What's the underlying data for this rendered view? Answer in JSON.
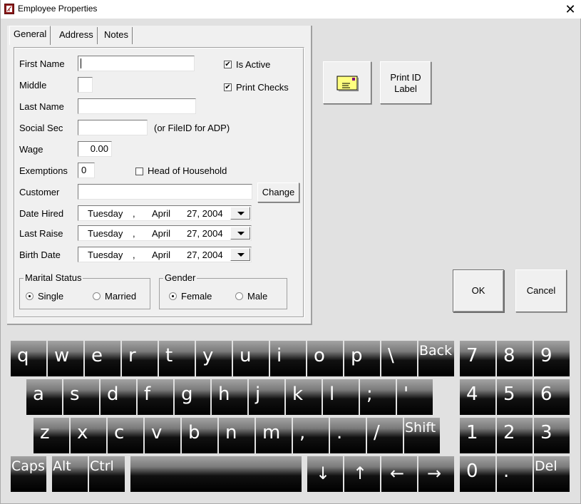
{
  "window": {
    "title": "Employee Properties",
    "close_icon": "close-icon",
    "app_icon": "app-icon"
  },
  "tabs": [
    {
      "label": "General",
      "active": true
    },
    {
      "label": "Address",
      "active": false
    },
    {
      "label": "Notes",
      "active": false
    }
  ],
  "form": {
    "first_name": {
      "label": "First Name",
      "value": ""
    },
    "middle": {
      "label": "Middle",
      "value": ""
    },
    "last_name": {
      "label": "Last Name",
      "value": ""
    },
    "social_sec": {
      "label": "Social Sec",
      "value": "",
      "hint": "(or FileID for ADP)"
    },
    "wage": {
      "label": "Wage",
      "value": "0.00"
    },
    "exemptions": {
      "label": "Exemptions",
      "value": "0"
    },
    "head_of_household": {
      "label": "Head of Household",
      "checked": false
    },
    "is_active": {
      "label": "Is Active",
      "checked": true
    },
    "print_checks": {
      "label": "Print Checks",
      "checked": true
    },
    "customer": {
      "label": "Customer",
      "value": "",
      "change_label": "Change"
    },
    "date_hired": {
      "label": "Date Hired",
      "weekday": "Tuesday",
      "sep": ",",
      "month": "April",
      "dayyear": "27, 2004"
    },
    "last_raise": {
      "label": "Last Raise",
      "weekday": "Tuesday",
      "sep": ",",
      "month": "April",
      "dayyear": "27, 2004"
    },
    "birth_date": {
      "label": "Birth Date",
      "weekday": "Tuesday",
      "sep": ",",
      "month": "April",
      "dayyear": "27, 2004"
    },
    "marital_status": {
      "title": "Marital Status",
      "options": [
        "Single",
        "Married"
      ],
      "selected": "Single"
    },
    "gender": {
      "title": "Gender",
      "options": [
        "Female",
        "Male"
      ],
      "selected": "Female"
    }
  },
  "buttons": {
    "envelope_icon": "envelope-icon",
    "print_id_label_line1": "Print ID",
    "print_id_label_line2": "Label",
    "ok": "OK",
    "cancel": "Cancel"
  },
  "keyboard": {
    "row1": [
      "q",
      "w",
      "e",
      "r",
      "t",
      "y",
      "u",
      "i",
      "o",
      "p",
      "\\",
      "Back"
    ],
    "row2": [
      "a",
      "s",
      "d",
      "f",
      "g",
      "h",
      "j",
      "k",
      "l",
      ";",
      "'"
    ],
    "row3": [
      "z",
      "x",
      "c",
      "v",
      "b",
      "n",
      "m",
      ",",
      ".",
      "/",
      "Shift"
    ],
    "row4": [
      "Caps",
      "Alt",
      "Ctrl"
    ],
    "arrows": [
      "↓",
      "↑",
      "←",
      "→"
    ],
    "numpad": [
      [
        "7",
        "8",
        "9"
      ],
      [
        "4",
        "5",
        "6"
      ],
      [
        "1",
        "2",
        "3"
      ],
      [
        "0",
        ".",
        "Del"
      ]
    ]
  }
}
